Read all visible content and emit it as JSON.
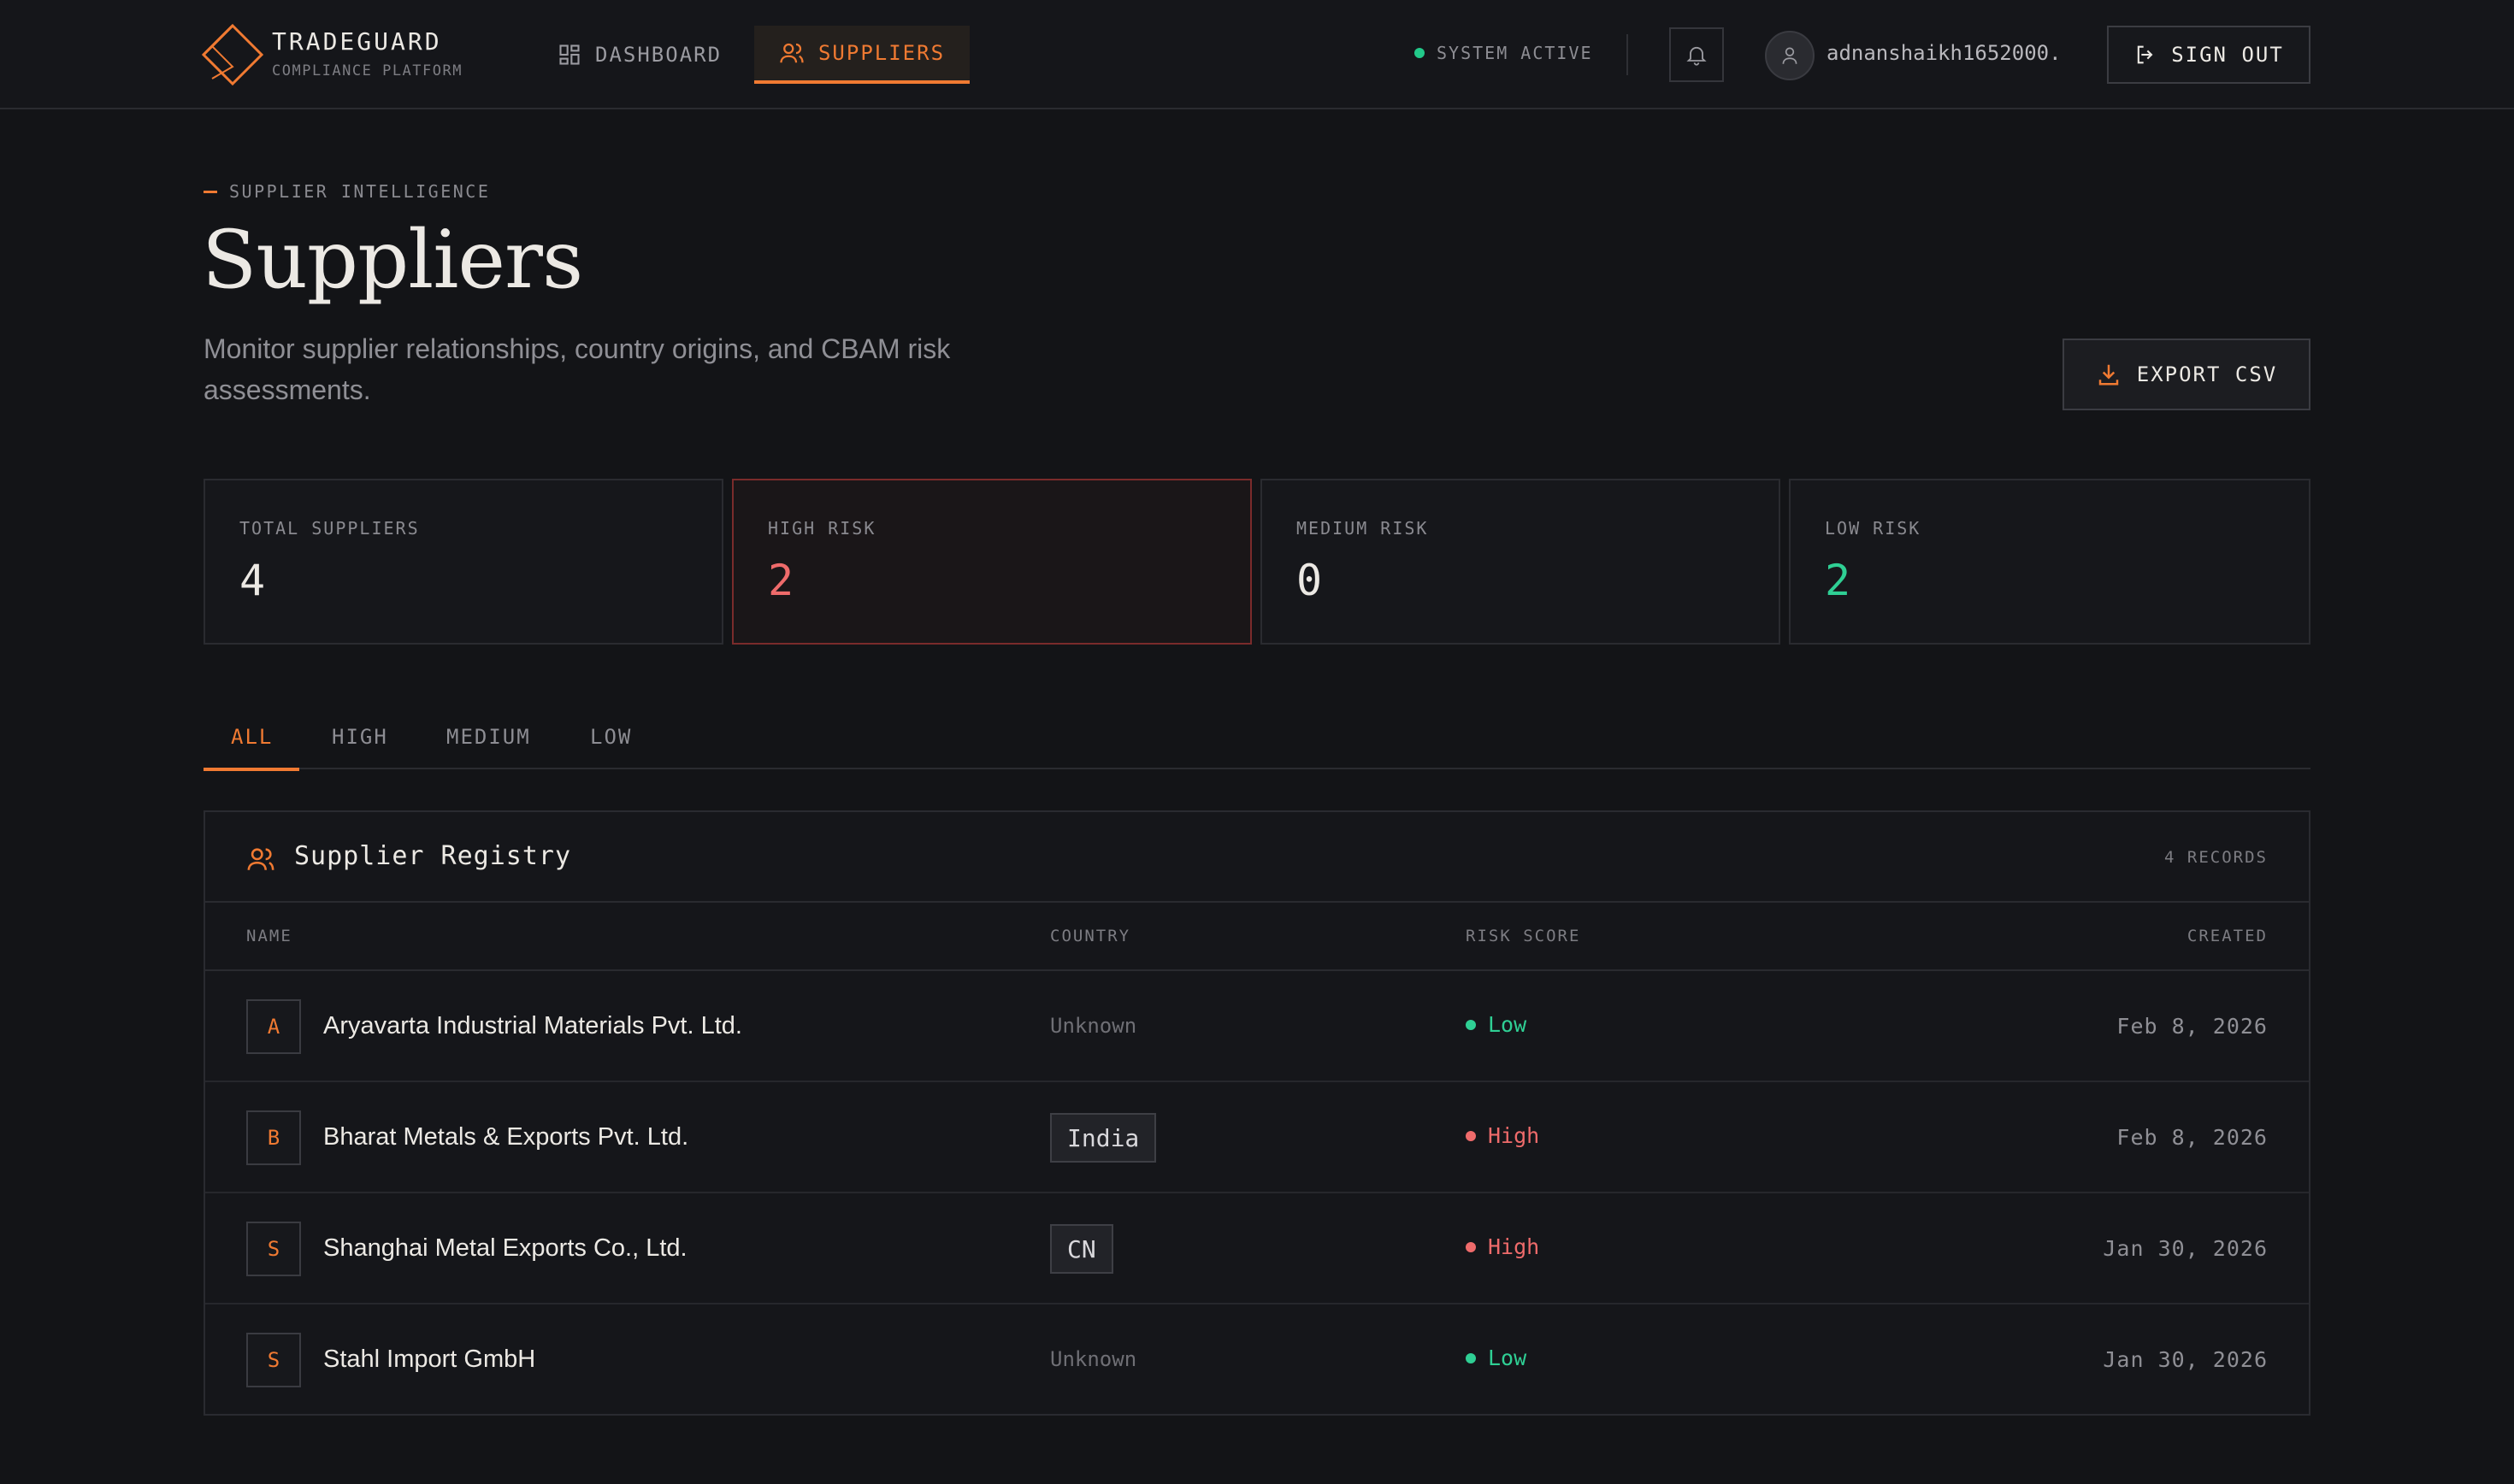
{
  "header": {
    "brand_name": "TRADEGUARD",
    "brand_sub": "COMPLIANCE PLATFORM",
    "nav": [
      {
        "label": "DASHBOARD",
        "icon": "grid-icon",
        "active": false
      },
      {
        "label": "SUPPLIERS",
        "icon": "users-icon",
        "active": true
      }
    ],
    "status_text": "SYSTEM ACTIVE",
    "user_email": "adnanshaikh1652000...",
    "sign_out_label": "SIGN OUT"
  },
  "page": {
    "eyebrow": "SUPPLIER INTELLIGENCE",
    "title": "Suppliers",
    "description": "Monitor supplier relationships, country origins, and CBAM risk assessments.",
    "export_label": "EXPORT CSV"
  },
  "stats": [
    {
      "label": "TOTAL SUPPLIERS",
      "value": "4",
      "color": "#ece9e4"
    },
    {
      "label": "HIGH RISK",
      "value": "2",
      "color": "#ef6b6b"
    },
    {
      "label": "MEDIUM RISK",
      "value": "0",
      "color": "#ece9e4"
    },
    {
      "label": "LOW RISK",
      "value": "2",
      "color": "#2fcf94"
    }
  ],
  "tabs": [
    "ALL",
    "HIGH",
    "MEDIUM",
    "LOW"
  ],
  "table": {
    "title": "Supplier Registry",
    "count": "4 RECORDS",
    "columns": {
      "name": "NAME",
      "country": "COUNTRY",
      "risk": "RISK SCORE",
      "created": "CREATED"
    },
    "rows": [
      {
        "initial": "A",
        "name": "Aryavarta Industrial Materials Pvt. Ltd.",
        "country": "Unknown",
        "country_known": false,
        "risk": "Low",
        "created": "Feb 8, 2026"
      },
      {
        "initial": "B",
        "name": "Bharat Metals & Exports Pvt. Ltd.",
        "country": "India",
        "country_known": true,
        "risk": "High",
        "created": "Feb 8, 2026"
      },
      {
        "initial": "S",
        "name": "Shanghai Metal Exports Co., Ltd.",
        "country": "CN",
        "country_known": true,
        "risk": "High",
        "created": "Jan 30, 2026"
      },
      {
        "initial": "S",
        "name": "Stahl Import GmbH",
        "country": "Unknown",
        "country_known": false,
        "risk": "Low",
        "created": "Jan 30, 2026"
      }
    ]
  },
  "colors": {
    "accent": "#f07a32",
    "risk_high": "#ef6b6b",
    "risk_low": "#2fcf94",
    "status_active": "#22c98a"
  }
}
